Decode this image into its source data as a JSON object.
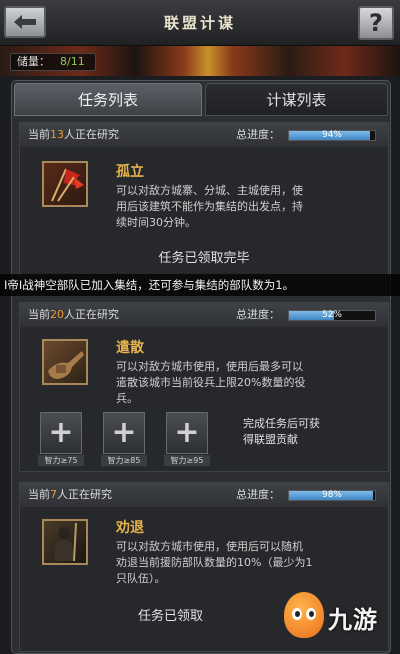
{
  "header": {
    "title": "联盟计谋",
    "back_icon": "back-arrow-icon",
    "help_label": "?"
  },
  "storage": {
    "label": "储量：",
    "value": "8/11"
  },
  "tabs": [
    {
      "label": "任务列表",
      "active": true
    },
    {
      "label": "计谋列表",
      "active": false
    }
  ],
  "progress_label": "总进度：",
  "cards": [
    {
      "researching_prefix": "当前",
      "researching_count": "13",
      "researching_suffix": "人正在研究",
      "progress": "94%",
      "progress_value": 94,
      "name": "孤立",
      "desc": [
        "可以对敌方城寨、分城、主城使用，使",
        "用后该建筑不能作为集结的出发点，持",
        "续时间30分钟。"
      ],
      "status": "任务已领取完毕",
      "icon": "red-flags-icon"
    },
    {
      "researching_prefix": "当前",
      "researching_count": "20",
      "researching_suffix": "人正在研究",
      "progress": "52%",
      "progress_value": 52,
      "name": "遣散",
      "desc": [
        "可以对敌方城市使用，使用后最多可以",
        "遣散该城市当前役兵上限20%数量的役",
        "兵。"
      ],
      "slots": [
        {
          "icon": "plus-icon",
          "req": "智力≥75"
        },
        {
          "icon": "plus-icon",
          "req": "智力≥85"
        },
        {
          "icon": "plus-icon",
          "req": "智力≥95"
        }
      ],
      "reward_text": [
        "完成任务后可获",
        "得联盟贡献"
      ],
      "icon": "gauntlet-icon"
    },
    {
      "researching_prefix": "当前",
      "researching_count": "7",
      "researching_suffix": "人正在研究",
      "progress": "98%",
      "progress_value": 98,
      "name": "劝退",
      "desc": [
        "可以对敌方城市使用，使用后可以随机",
        "劝退当前援防部队数量的10%（最少为1",
        "只队伍）。"
      ],
      "status": "任务已领取",
      "icon": "warrior-icon"
    }
  ],
  "ticker": "I帝I战神空部队已加入集结，还可参与集结的部队数为1。",
  "watermark": {
    "text": "九游",
    "icon": "jiuyou-logo-icon"
  },
  "colors": {
    "accent_orange": "#e59b3a",
    "skill_gold": "#e6b24c",
    "progress_blue": "#4f95d0"
  }
}
